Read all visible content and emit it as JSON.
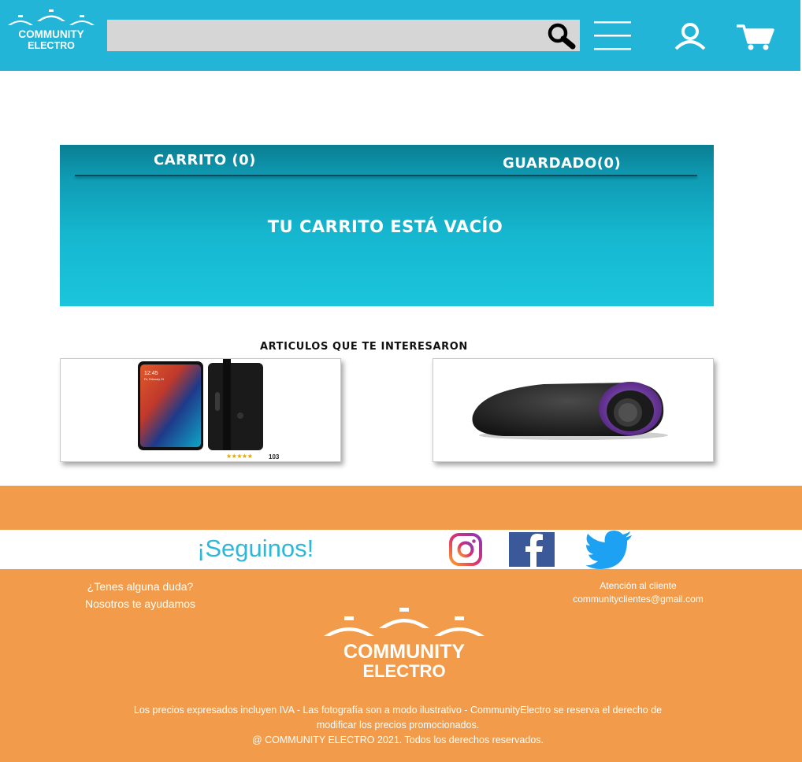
{
  "header": {
    "logo_line1": "COMMUNITY",
    "logo_line2": "ELECTRO",
    "search": {
      "value": "",
      "placeholder": ""
    },
    "icons": [
      "search-icon",
      "menu-icon",
      "user-icon",
      "cart-icon"
    ]
  },
  "cart": {
    "tab_cart": "CARRITO (0)",
    "tab_saved": "GUARDADO(0)",
    "empty_message": "TU CARRITO ESTÁ VACÍO"
  },
  "recommendations": {
    "title": "ARTICULOS QUE TE INTERESARON",
    "items": [
      {
        "name": "phone",
        "rating_count": "103",
        "stars": "★★★★★"
      },
      {
        "name": "speaker"
      }
    ]
  },
  "footer": {
    "follow_label": "¡Seguinos!",
    "social": [
      "instagram-icon",
      "facebook-icon",
      "twitter-icon"
    ],
    "help_line1": "¿Tenes alguna duda?",
    "help_line2": "Nosotros te ayudamos",
    "contact_line1": "Atención al cliente",
    "contact_line2": "communityclientes@gmail.com",
    "logo_line1": "COMMUNITY",
    "logo_line2": "ELECTRO",
    "legal_line1": "Los precios expresados incluyen IVA - Las fotografía son a modo ilustrativo - CommunityElectro se reserva el derecho de",
    "legal_line2": "modificar los precios promocionados.",
    "legal_line3": "@ COMMUNITY ELECTRO 2021. Todos los derechos reservados."
  },
  "colors": {
    "header": "#23b5d8",
    "footer": "#f29c4b",
    "accent": "#2eb7d8"
  }
}
